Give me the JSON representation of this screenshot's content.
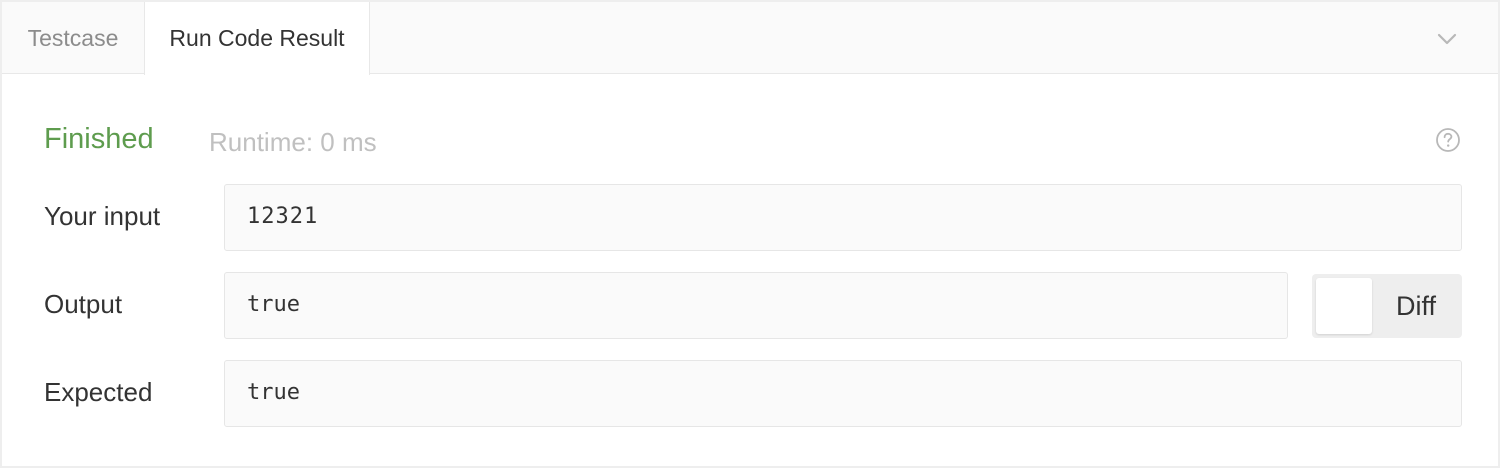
{
  "tabs": [
    {
      "label": "Testcase",
      "active": false
    },
    {
      "label": "Run Code Result",
      "active": true
    }
  ],
  "icons": {
    "collapse": "chevron-down-icon",
    "help": "help-circle-icon"
  },
  "result": {
    "status": "Finished",
    "runtime": "Runtime: 0 ms",
    "status_color": "#5e9c4e"
  },
  "rows": {
    "input": {
      "label": "Your input",
      "value": "12321"
    },
    "output": {
      "label": "Output",
      "value": "true"
    },
    "expected": {
      "label": "Expected",
      "value": "true"
    }
  },
  "diff": {
    "label": "Diff",
    "enabled": false
  }
}
